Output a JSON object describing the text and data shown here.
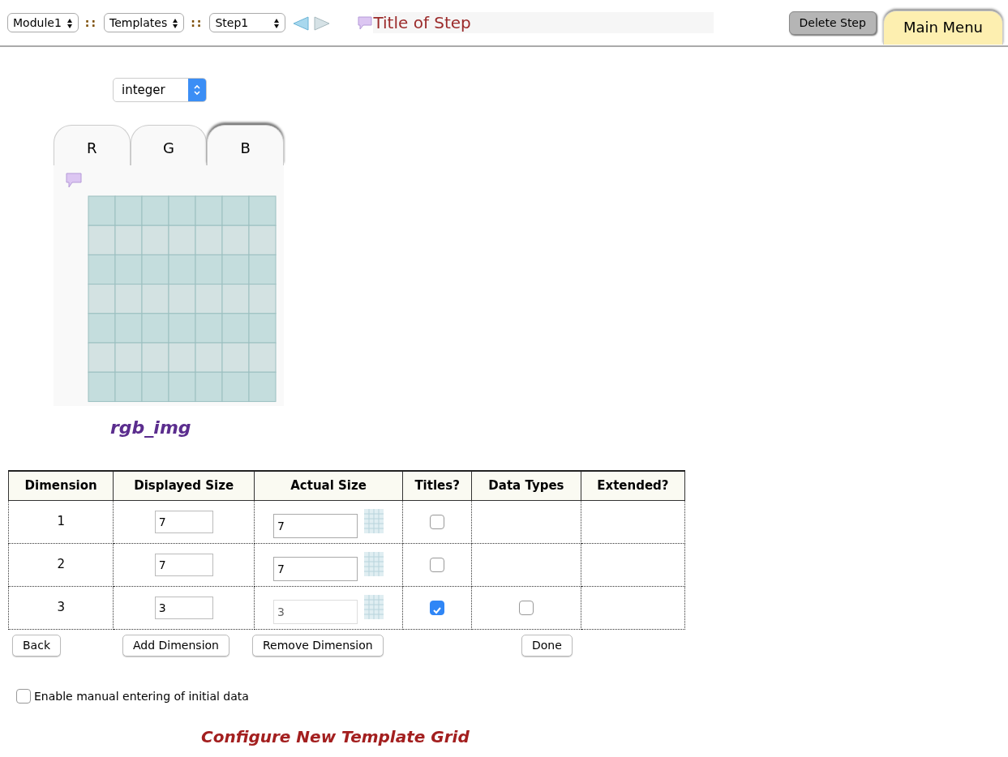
{
  "toolbar": {
    "module_select": "Module1",
    "template_select": "Templates",
    "step_select": "Step1",
    "separators": [
      "::",
      "::"
    ],
    "step_title": "Title of Step",
    "delete_button": "Delete Step",
    "main_menu": "Main Menu"
  },
  "type_select": "integer",
  "channel_tabs": [
    {
      "label": "R",
      "selected": false
    },
    {
      "label": "G",
      "selected": false
    },
    {
      "label": "B",
      "selected": true
    }
  ],
  "grid_name": "rgb_img",
  "table": {
    "columns": [
      "Dimension",
      "Displayed Size",
      "Actual Size",
      "Titles?",
      "Data Types",
      "Extended?"
    ],
    "rows": [
      {
        "dimension": "1",
        "displayed_size": "7",
        "actual_size": "7",
        "actual_disabled": false,
        "titles": false
      },
      {
        "dimension": "2",
        "displayed_size": "7",
        "actual_size": "7",
        "actual_disabled": false,
        "titles": false
      },
      {
        "dimension": "3",
        "displayed_size": "3",
        "actual_size": "3",
        "actual_disabled": true,
        "titles": true,
        "data_types": {
          "checked": false
        }
      }
    ]
  },
  "buttons": {
    "back": "Back",
    "add": "Add Dimension",
    "remove": "Remove Dimension",
    "done": "Done"
  },
  "manual_entry": {
    "label": "Enable manual entering of initial data",
    "checked": false
  },
  "footer_title": "Configure New Template Grid"
}
